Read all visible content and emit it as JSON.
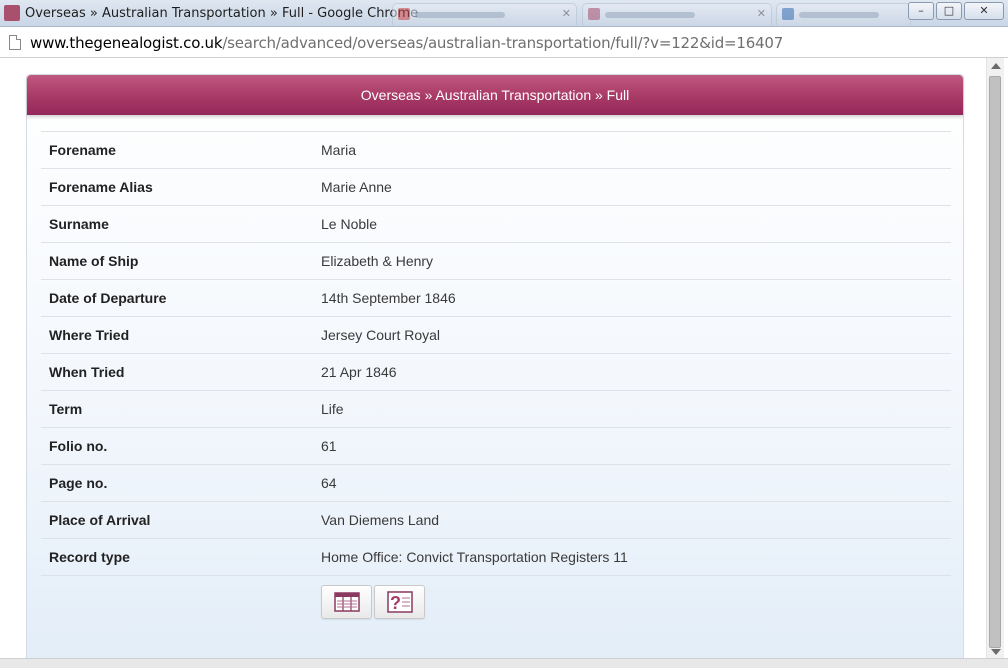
{
  "window": {
    "title": "Overseas » Australian Transportation » Full - Google Chrome",
    "controls": {
      "minimize": "–",
      "maximize": "□",
      "close": "✕"
    },
    "accent": "#a9506f"
  },
  "address": {
    "host": "www.thegenealogist.co.uk",
    "path": "/search/advanced/overseas/australian-transportation/full/?v=122&id=16407"
  },
  "panel": {
    "title": "Overseas » Australian Transportation » Full",
    "header_color": "#a83a66"
  },
  "record": [
    {
      "label": "Forename",
      "value": "Maria"
    },
    {
      "label": "Forename Alias",
      "value": "Marie Anne"
    },
    {
      "label": "Surname",
      "value": "Le Noble"
    },
    {
      "label": "Name of Ship",
      "value": "Elizabeth & Henry"
    },
    {
      "label": "Date of Departure",
      "value": "14th September 1846"
    },
    {
      "label": "Where Tried",
      "value": "Jersey Court Royal"
    },
    {
      "label": "When Tried",
      "value": "21 Apr 1846"
    },
    {
      "label": "Term",
      "value": "Life"
    },
    {
      "label": "Folio no.",
      "value": "61"
    },
    {
      "label": "Page no.",
      "value": "64"
    },
    {
      "label": "Place of Arrival",
      "value": "Van Diemens Land"
    },
    {
      "label": "Record type",
      "value": "Home Office: Convict Transportation Registers 11"
    }
  ],
  "actions": [
    {
      "icon": "view-image-icon"
    },
    {
      "icon": "help-icon"
    }
  ]
}
